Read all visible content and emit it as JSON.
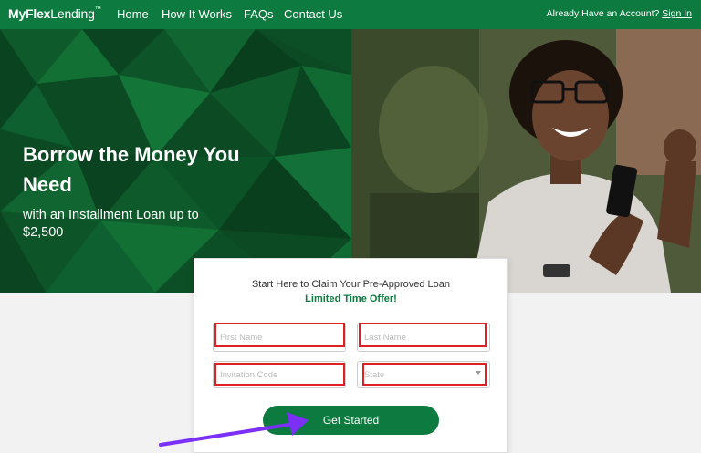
{
  "brand": {
    "name_bold": "MyFlex",
    "name_regular": "Lending",
    "trademark": "™"
  },
  "nav": {
    "links": [
      "Home",
      "How It Works",
      "FAQs",
      "Contact Us"
    ],
    "account_text": "Already Have an Account?",
    "signin_label": "Sign In"
  },
  "hero": {
    "title": "Borrow the Money You Need",
    "subtitle": "with an Installment Loan up to $2,500"
  },
  "form": {
    "heading": "Start Here to Claim Your Pre-Approved Loan",
    "offer": "Limited Time Offer!",
    "first_name_placeholder": "First Name",
    "last_name_placeholder": "Last Name",
    "invitation_code_placeholder": "Invitation Code",
    "state_placeholder": "State",
    "submit_label": "Get Started"
  },
  "colors": {
    "brand_green": "#0d7a3f",
    "highlight_red": "#e02020",
    "arrow_purple": "#7b2ff7"
  }
}
